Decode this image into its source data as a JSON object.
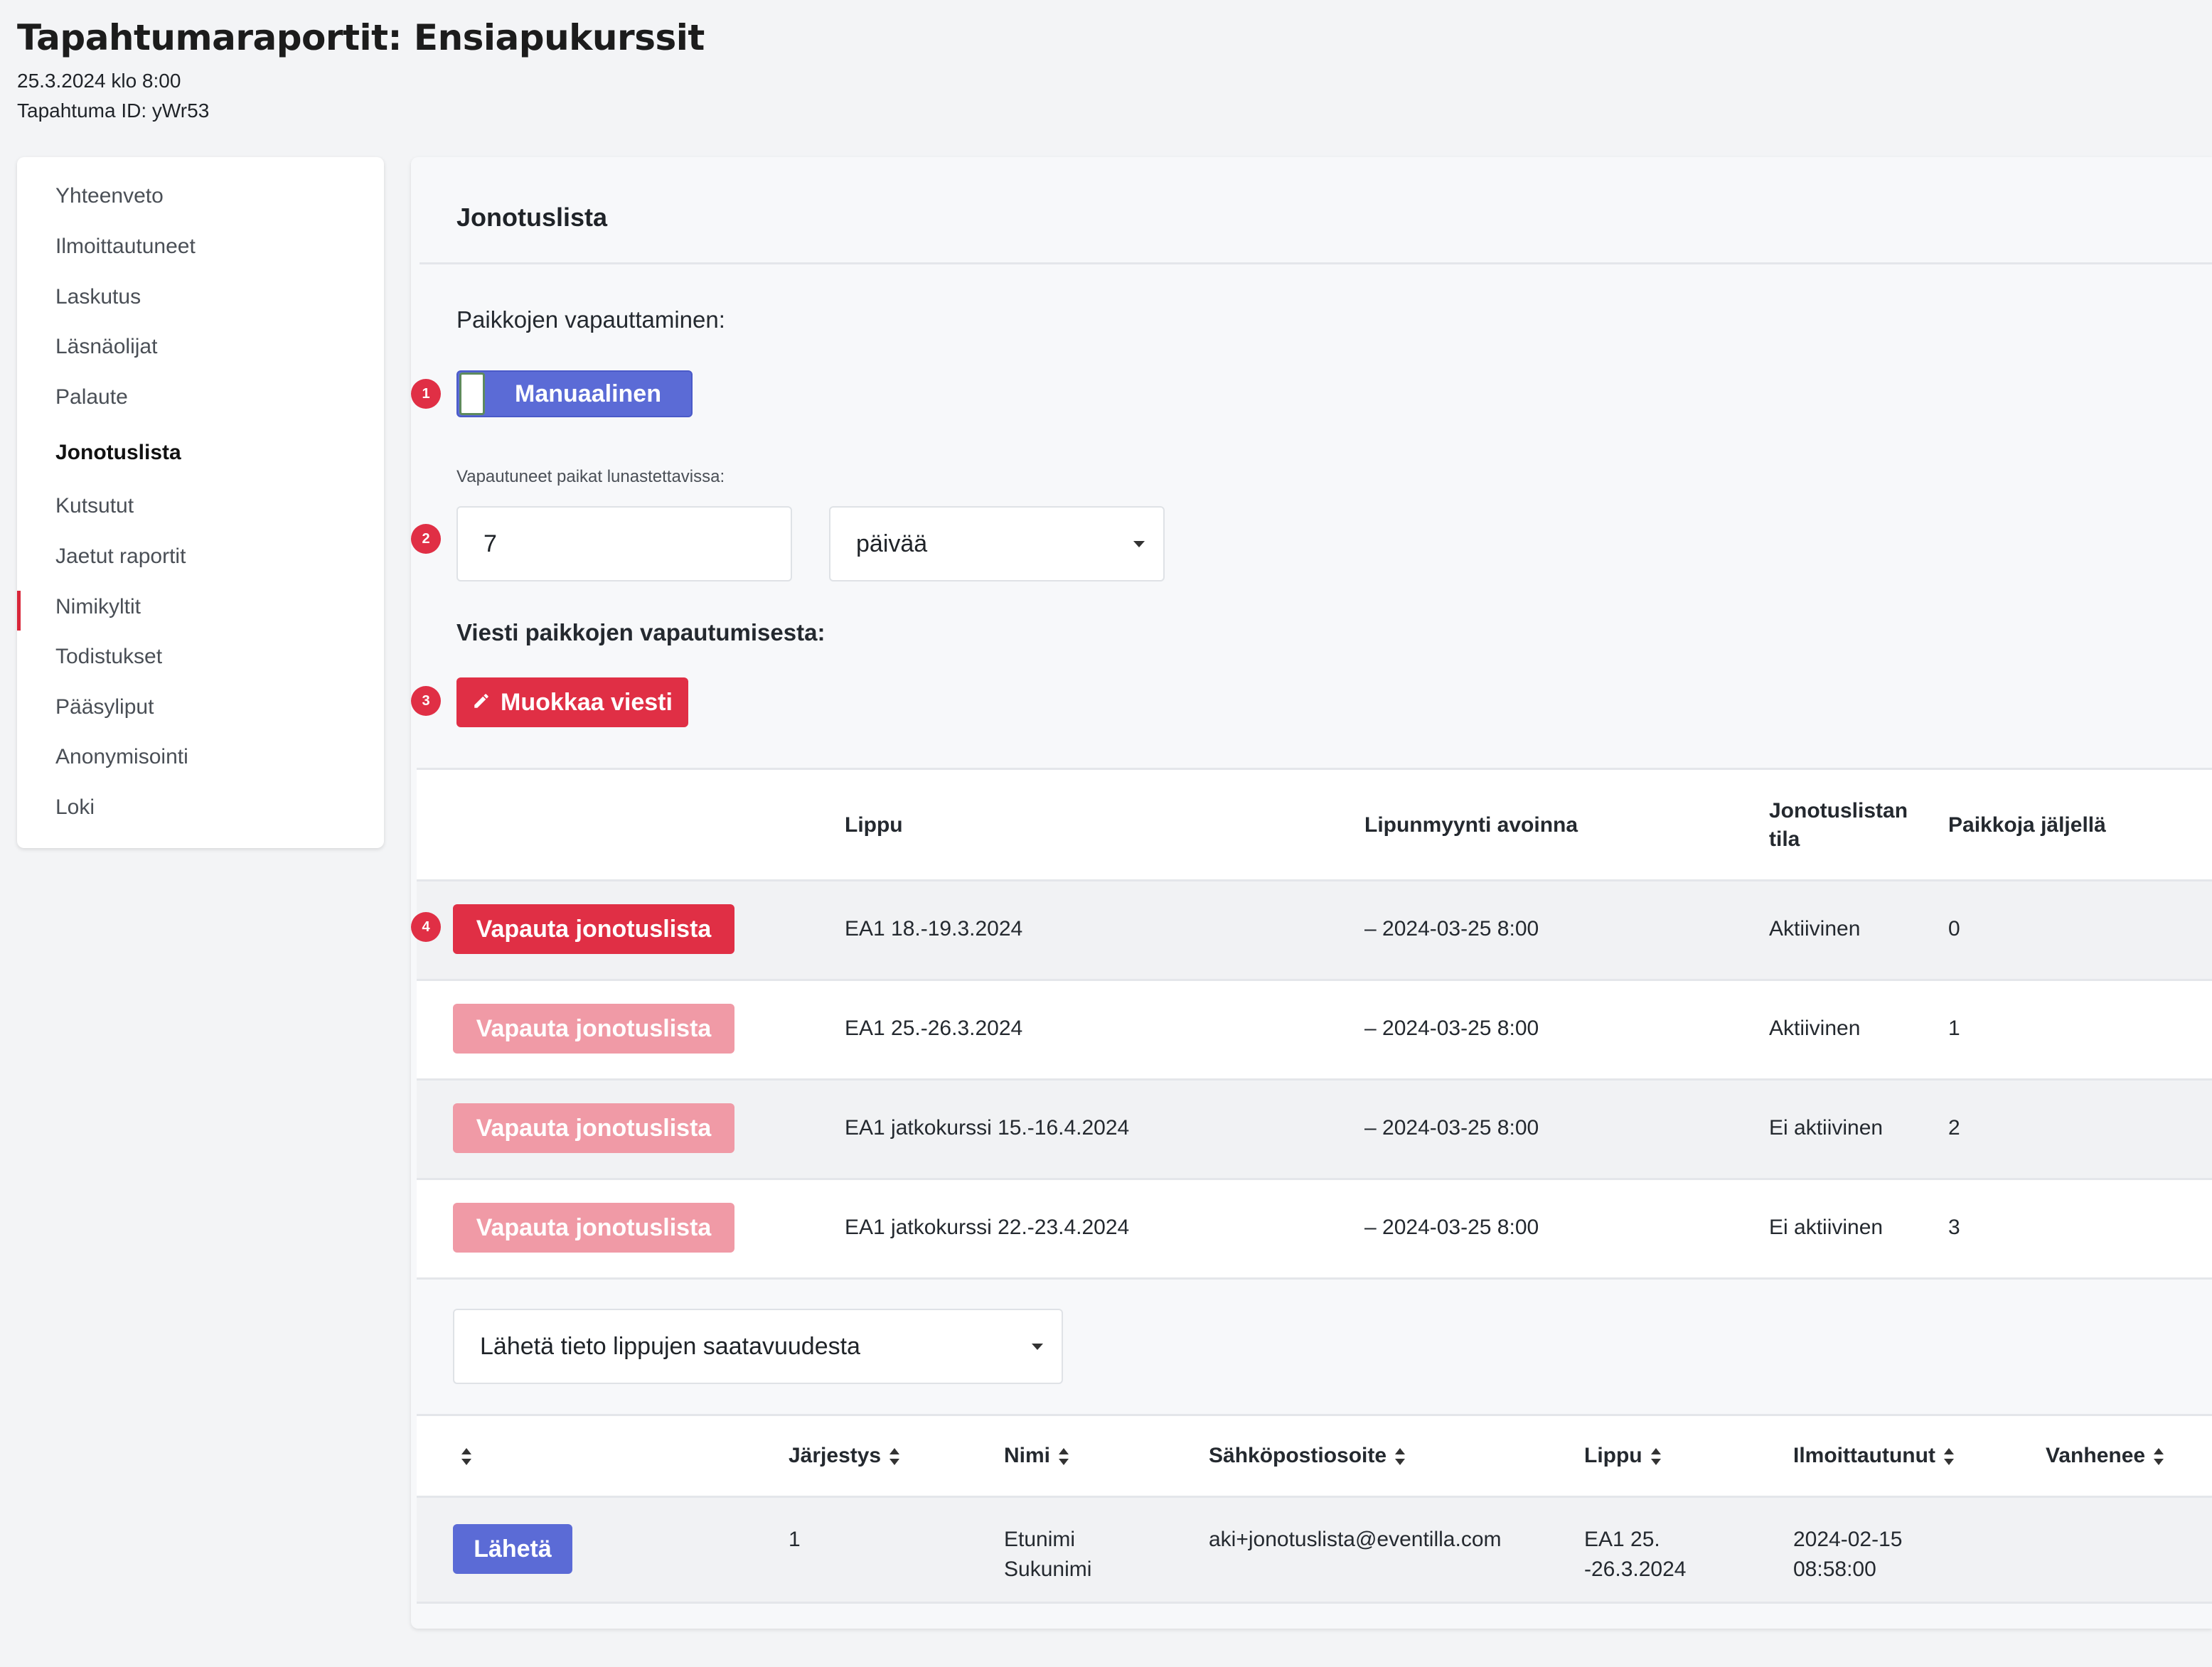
{
  "header": {
    "title": "Tapahtumaraportit: Ensiapukurssit",
    "date": "25.3.2024 klo 8:00",
    "event_id": "Tapahtuma ID: yWr53"
  },
  "sidebar": {
    "items": [
      {
        "label": "Yhteenveto"
      },
      {
        "label": "Ilmoittautuneet"
      },
      {
        "label": "Laskutus"
      },
      {
        "label": "Läsnäolijat"
      },
      {
        "label": "Palaute"
      },
      {
        "label": "Jonotuslista",
        "active": true
      },
      {
        "label": "Kutsutut"
      },
      {
        "label": "Jaetut raportit"
      },
      {
        "label": "Nimikyltit"
      },
      {
        "label": "Todistukset"
      },
      {
        "label": "Pääsyliput"
      },
      {
        "label": "Anonymisointi"
      },
      {
        "label": "Loki"
      }
    ],
    "active_color": "#d9263a"
  },
  "main": {
    "title": "Jonotuslista",
    "release_label": "Paikkojen vapauttaminen:",
    "mode_toggle": "Manuaalinen",
    "claim_label": "Vapautuneet paikat lunastettavissa:",
    "claim_value": "7",
    "claim_unit": "päivää",
    "message_label": "Viesti paikkojen vapautumisesta:",
    "edit_message_button": "Muokkaa viesti",
    "badges": [
      "1",
      "2",
      "3",
      "4"
    ]
  },
  "ticket_table": {
    "headers": {
      "ticket": "Lippu",
      "sales_open": "Lipunmyynti avoinna",
      "queue_status_line1": "Jonotuslistan",
      "queue_status_line2": "tila",
      "seats_left": "Paikkoja jäljellä"
    },
    "rows": [
      {
        "button": "Vapauta jonotuslista",
        "ticket": "EA1 18.-19.3.2024",
        "sales_open": "– 2024-03-25 8:00",
        "status": "Aktiivinen",
        "seats": "0",
        "enabled": true
      },
      {
        "button": "Vapauta jonotuslista",
        "ticket": "EA1 25.-26.3.2024",
        "sales_open": "– 2024-03-25 8:00",
        "status": "Aktiivinen",
        "seats": "1",
        "enabled": false
      },
      {
        "button": "Vapauta jonotuslista",
        "ticket": "EA1 jatkokurssi 15.-16.4.2024",
        "sales_open": "– 2024-03-25 8:00",
        "status": "Ei aktiivinen",
        "seats": "2",
        "enabled": false
      },
      {
        "button": "Vapauta jonotuslista",
        "ticket": "EA1 jatkokurssi 22.-23.4.2024",
        "sales_open": "– 2024-03-25 8:00",
        "status": "Ei aktiivinen",
        "seats": "3",
        "enabled": false
      }
    ]
  },
  "notify_select": "Lähetä tieto lippujen saatavuudesta",
  "queue_table": {
    "headers": {
      "order": "Järjestys",
      "name": "Nimi",
      "email": "Sähköpostiosoite",
      "ticket": "Lippu",
      "registered": "Ilmoittautunut",
      "expires": "Vanhenee"
    },
    "rows": [
      {
        "button": "Lähetä",
        "order": "1",
        "name_line1": "Etunimi",
        "name_line2": "Sukunimi",
        "email": "aki+jonotuslista@eventilla.com",
        "ticket_line1": "EA1 25.",
        "ticket_line2": "-26.3.2024",
        "registered_line1": "2024-02-15",
        "registered_line2": "08:58:00",
        "expires": ""
      }
    ]
  },
  "colors": {
    "accent_red": "#e02f45",
    "accent_red_faded": "#f09aa6",
    "accent_blue": "#5b6bd6"
  }
}
